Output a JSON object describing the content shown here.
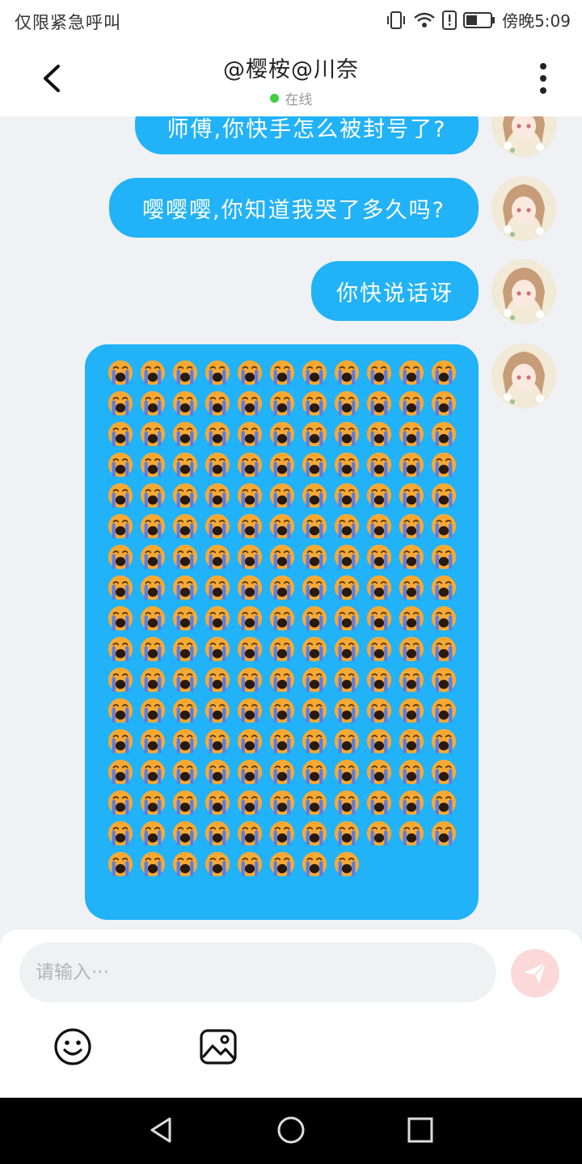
{
  "status_bar": {
    "left_text": "仅限紧急呼叫",
    "time": "傍晚5:09",
    "icons": [
      "vibrate-icon",
      "wifi-icon",
      "alert-icon",
      "battery-icon"
    ]
  },
  "header": {
    "title": "@樱桉@川奈",
    "presence": "在线",
    "presence_color": "#3fcf3f"
  },
  "messages": [
    {
      "text": "师傅,你快手怎么被封号了?"
    },
    {
      "text": "嘤嘤嘤,你知道我哭了多久吗?"
    },
    {
      "text": "你快说话讶"
    },
    {
      "text": "😭 × 184",
      "emoji": "crying-face",
      "count": 184
    }
  ],
  "composer": {
    "placeholder": "请输入···",
    "tools": [
      "smiley-icon",
      "image-icon"
    ],
    "send_icon": "paper-plane-icon"
  },
  "colors": {
    "bubble": "#22b2f8",
    "background": "#eff1f5",
    "send_button": "#fcd9d9"
  },
  "nav": [
    "back-triangle-icon",
    "home-circle-icon",
    "recents-square-icon"
  ]
}
